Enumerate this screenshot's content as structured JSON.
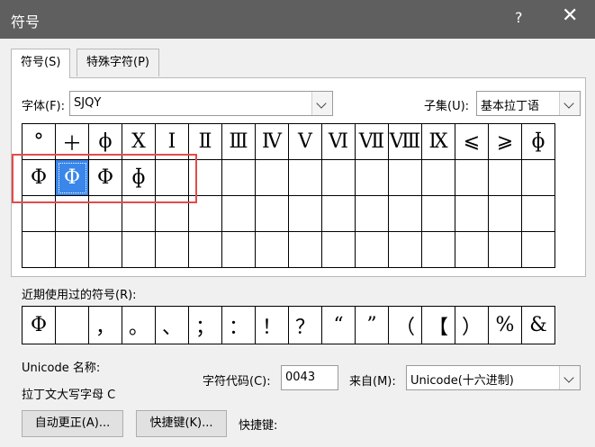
{
  "window": {
    "title": "符号",
    "help_glyph": "?",
    "close_glyph": "✕"
  },
  "tabs": [
    {
      "label": "符号(S)",
      "active": true
    },
    {
      "label": "特殊字符(P)",
      "active": false
    }
  ],
  "font": {
    "label": "字体(F):",
    "value": "SJQY"
  },
  "subset": {
    "label": "子集(U):",
    "value": "基本拉丁语"
  },
  "symbol_grid": {
    "rows": [
      [
        "°",
        "＋",
        "ϕ",
        "Ⅹ",
        "Ⅰ",
        "Ⅱ",
        "Ⅲ",
        "Ⅳ",
        "Ⅴ",
        "Ⅵ",
        "Ⅶ",
        "Ⅷ",
        "Ⅸ",
        "⩽",
        "⩾",
        "ɸ"
      ],
      [
        "Φ",
        "Φ",
        "Φ",
        "ɸ",
        "",
        "",
        "",
        "",
        "",
        "",
        "",
        "",
        "",
        "",
        "",
        ""
      ],
      [
        "",
        "",
        "",
        "",
        "",
        "",
        "",
        "",
        "",
        "",
        "",
        "",
        "",
        "",
        "",
        ""
      ],
      [
        "",
        "",
        "",
        "",
        "",
        "",
        "",
        "",
        "",
        "",
        "",
        "",
        "",
        "",
        "",
        ""
      ]
    ],
    "selected": [
      1,
      1
    ]
  },
  "recent": {
    "label": "近期使用过的符号(R):",
    "symbols": [
      "Φ",
      "",
      "，",
      "。",
      "、",
      "；",
      "：",
      "！",
      "？",
      "“",
      "”",
      "（",
      "【",
      "）",
      "%",
      "&"
    ]
  },
  "unicode_name": {
    "label": "Unicode 名称:",
    "value": "拉丁文大写字母 C"
  },
  "char_code": {
    "label": "字符代码(C):",
    "value": "0043"
  },
  "from": {
    "label": "来自(M):",
    "value": "Unicode(十六进制)"
  },
  "buttons": {
    "autocorrect": "自动更正(A)...",
    "shortcut_key": "快捷键(K)...",
    "shortcut_label": "快捷键:"
  }
}
